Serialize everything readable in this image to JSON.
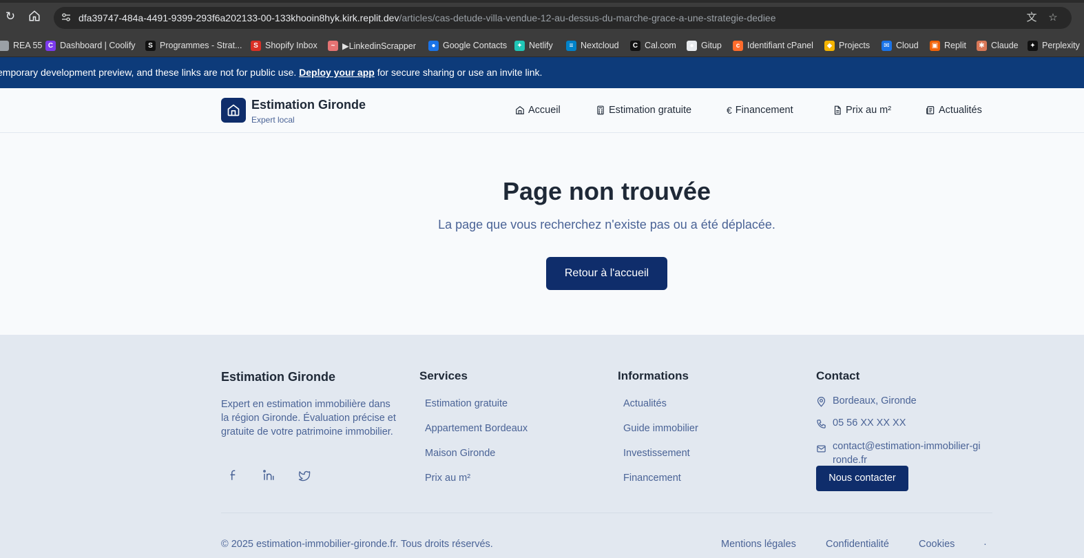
{
  "browser": {
    "url_host": "dfa39747-484a-4491-9399-293f6a202133-00-133khooin8hyk.kirk.replit.dev",
    "url_path": "/articles/cas-detude-villa-vendue-12-au-dessus-du-marche-grace-a-une-strategie-dediee",
    "bookmarks": [
      {
        "label": "REA 55",
        "icon": "page-icon",
        "color": "#9aa0a6"
      },
      {
        "label": "Dashboard | Coolify",
        "icon": "coolify-icon",
        "color": "#7c3aed"
      },
      {
        "label": "Programmes - Strat...",
        "icon": "s-icon",
        "color": "#111111"
      },
      {
        "label": "Shopify Inbox",
        "icon": "s-icon",
        "color": "#d93025"
      },
      {
        "label": "▶LinkedinScrapper",
        "icon": "scraper-icon",
        "color": "#e57373"
      },
      {
        "label": "Google Contacts",
        "icon": "contacts-icon",
        "color": "#1a73e8"
      },
      {
        "label": "Netlify",
        "icon": "netlify-icon",
        "color": "#20c6b7"
      },
      {
        "label": "Nextcloud",
        "icon": "nextcloud-icon",
        "color": "#0082c9"
      },
      {
        "label": "Cal.com",
        "icon": "cal-icon",
        "color": "#111111"
      },
      {
        "label": "Gitup",
        "icon": "github-icon",
        "color": "#e8eaed"
      },
      {
        "label": "Identifiant cPanel",
        "icon": "cpanel-icon",
        "color": "#ff6c2c"
      },
      {
        "label": "Projects",
        "icon": "projects-icon",
        "color": "#f4b400"
      },
      {
        "label": "Cloud",
        "icon": "mail-icon",
        "color": "#1a73e8"
      },
      {
        "label": "Replit",
        "icon": "replit-icon",
        "color": "#f26207"
      },
      {
        "label": "Claude",
        "icon": "claude-icon",
        "color": "#d97757"
      },
      {
        "label": "Perplexity",
        "icon": "perplexity-icon",
        "color": "#111111"
      }
    ]
  },
  "banner": {
    "text_before": "emporary development preview, and these links are not for public use. ",
    "link": "Deploy your app",
    "text_after": " for secure sharing or use an invite link."
  },
  "header": {
    "brand_title": "Estimation Gironde",
    "brand_subtitle": "Expert local",
    "nav": [
      {
        "label": "Accueil",
        "icon": "home-icon"
      },
      {
        "label": "Estimation gratuite",
        "icon": "calculator-icon"
      },
      {
        "label": "Financement",
        "icon": "euro-icon"
      },
      {
        "label": "Prix au m²",
        "icon": "document-icon"
      },
      {
        "label": "Actualités",
        "icon": "newspaper-icon"
      }
    ]
  },
  "main": {
    "title": "Page non trouvée",
    "subtitle": "La page que vous recherchez n'existe pas ou a été déplacée.",
    "button": "Retour à l'accueil"
  },
  "footer": {
    "brand": "Estimation Gironde",
    "description": "Expert en estimation immobilière dans la région Gironde. Évaluation précise et gratuite de votre patrimoine immobilier.",
    "services": {
      "title": "Services",
      "links": [
        "Estimation gratuite",
        "Appartement Bordeaux",
        "Maison Gironde",
        "Prix au m²"
      ]
    },
    "informations": {
      "title": "Informations",
      "links": [
        "Actualités",
        "Guide immobilier",
        "Investissement",
        "Financement"
      ]
    },
    "contact": {
      "title": "Contact",
      "location": "Bordeaux, Gironde",
      "phone": "05 56 XX XX XX",
      "email": "contact@estimation-immobilier-gironde.fr",
      "button": "Nous contacter"
    },
    "copyright": "© 2025 estimation-immobilier-gironde.fr. Tous droits réservés.",
    "legal": [
      "Mentions légales",
      "Confidentialité",
      "Cookies"
    ],
    "legal_dot": "·"
  },
  "colors": {
    "primary": "#0f2d6b",
    "muted_text": "#4a6396",
    "banner": "#0d3b7a"
  }
}
